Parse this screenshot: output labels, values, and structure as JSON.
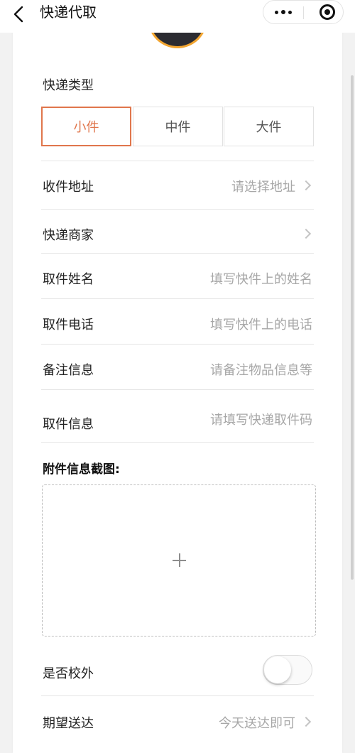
{
  "nav": {
    "title": "快递代取",
    "back_icon": "chevron-left-icon",
    "more_icon": "more-dots-icon",
    "close_icon": "target-circle-icon"
  },
  "form": {
    "type_label": "快递类型",
    "sizes": [
      {
        "label": "小件",
        "selected": true
      },
      {
        "label": "中件",
        "selected": false
      },
      {
        "label": "大件",
        "selected": false
      }
    ],
    "address": {
      "label": "收件地址",
      "placeholder": "请选择地址"
    },
    "merchant": {
      "label": "快递商家",
      "value": ""
    },
    "name": {
      "label": "取件姓名",
      "placeholder": "填写快件上的姓名"
    },
    "phone": {
      "label": "取件电话",
      "placeholder": "填写快件上的电话"
    },
    "remark": {
      "label": "备注信息",
      "placeholder": "请备注物品信息等"
    },
    "pickup": {
      "label": "取件信息",
      "placeholder": "请填写快递取件码"
    },
    "attachment_label": "附件信息截图:",
    "upload_icon": "plus-icon",
    "off_campus": {
      "label": "是否校外",
      "on": false
    },
    "eta": {
      "label": "期望送达",
      "value": "今天送达即可"
    }
  },
  "colors": {
    "accent": "#e0764c",
    "avatar_ring": "#f2a531",
    "placeholder": "#a7a7a7"
  }
}
